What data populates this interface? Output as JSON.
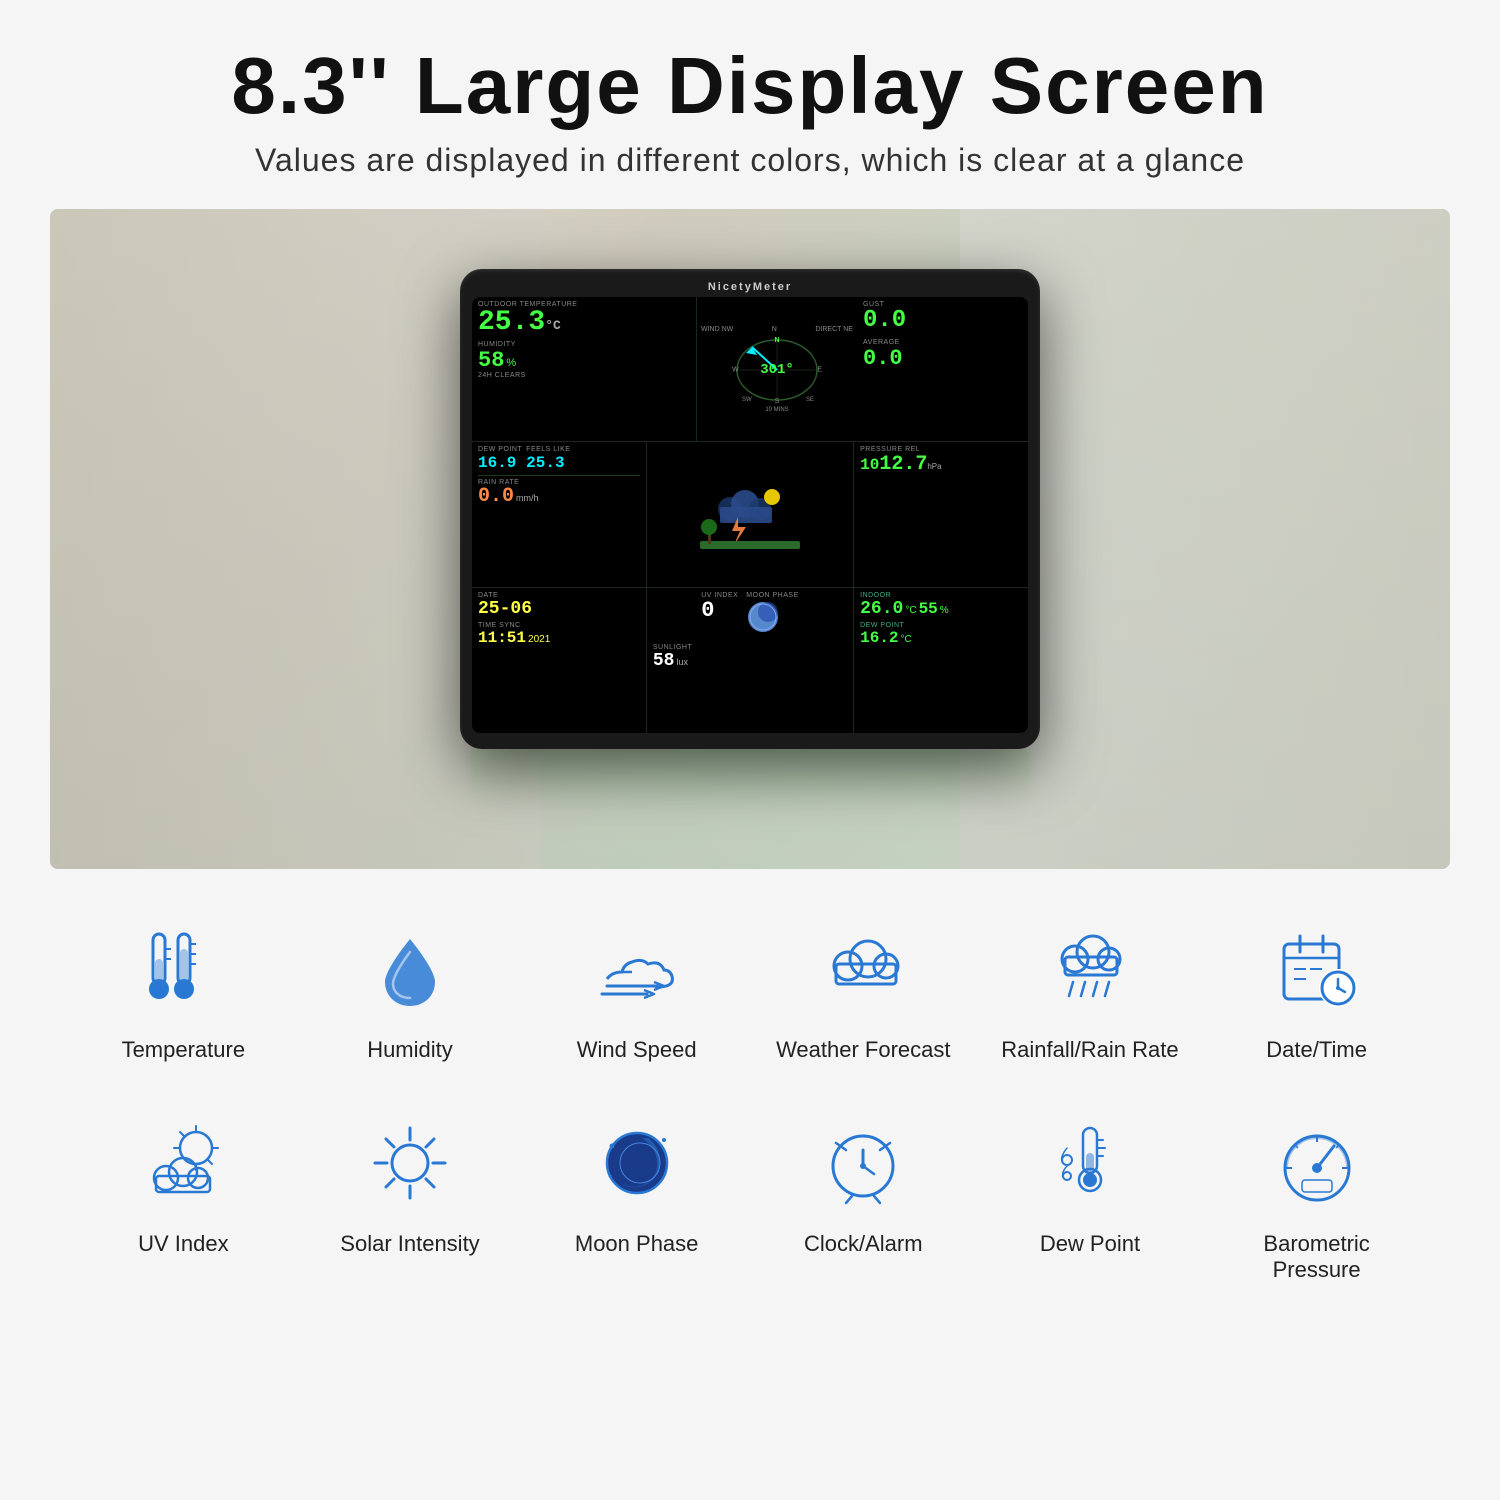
{
  "header": {
    "main_title": "8.3'' Large Display Screen",
    "subtitle": "Values are displayed in different colors, which is clear at a glance"
  },
  "device": {
    "brand": "NicetyMeter",
    "screen": {
      "outdoor_temp_label": "OUTDOOR TEMPERATURE",
      "outdoor_temp_value": "25.3",
      "outdoor_temp_unit": "°C",
      "humidity_label": "HUMIDITY",
      "humidity_value": "58",
      "humidity_unit": "%",
      "humidity_24h": "24h CLEARS",
      "wind_label": "WIND NW",
      "wind_direction_label": "DIRECT NE",
      "wind_compass_value": "301",
      "wind_compass_deg": "°",
      "wind_speed_label": "10 MINS",
      "gust_label": "GUST",
      "gust_value": "0.0",
      "dew_point_label": "DEW POINT",
      "dew_point_value": "16.9",
      "feels_like_label": "FEELS LIKE",
      "feels_like_value": "25.3",
      "average_label": "AVERAGE",
      "average_value": "0.0",
      "rain_rate_label": "RAIN RATE",
      "rain_rate_value": "0.0",
      "rain_unit": "mm/h",
      "pressure_label": "PRESSURE REL",
      "pressure_value1": "10",
      "pressure_value2": "12.7",
      "pressure_unit": "hPa",
      "date_label": "DATE",
      "date_value": "25-06",
      "uv_label": "UV INDEX",
      "uv_value": "0",
      "moon_label": "MOON PHASE",
      "time_label": "TIME SYNC",
      "time_value": "11:51",
      "time_year": "2021",
      "sunlight_label": "SUNLIGHT",
      "sunlight_value": "58",
      "sunlight_unit": "lux",
      "indoor_label": "INDOOR",
      "indoor_temp": "26.0",
      "indoor_temp_unit": "°C",
      "indoor_humidity": "55",
      "indoor_humidity_unit": "%",
      "indoor_dew_label": "DEW POINT",
      "indoor_dew_value": "16.2",
      "indoor_dew_unit": "°C"
    }
  },
  "features_row1": [
    {
      "id": "temperature",
      "label": "Temperature",
      "icon": "thermometer"
    },
    {
      "id": "humidity",
      "label": "Humidity",
      "icon": "droplet"
    },
    {
      "id": "wind-speed",
      "label": "Wind Speed",
      "icon": "wind"
    },
    {
      "id": "weather-forecast",
      "label": "Weather Forecast",
      "icon": "cloud"
    },
    {
      "id": "rainfall",
      "label": "Rainfall/Rain Rate",
      "icon": "rain-cloud"
    },
    {
      "id": "datetime",
      "label": "Date/Time",
      "icon": "calendar-clock"
    }
  ],
  "features_row2": [
    {
      "id": "uv-index",
      "label": "UV Index",
      "icon": "uv-cloud"
    },
    {
      "id": "solar-intensity",
      "label": "Solar Intensity",
      "icon": "sun"
    },
    {
      "id": "moon-phase",
      "label": "Moon Phase",
      "icon": "moon"
    },
    {
      "id": "clock-alarm",
      "label": "Clock/Alarm",
      "icon": "clock"
    },
    {
      "id": "dew-point",
      "label": "Dew Point",
      "icon": "dew"
    },
    {
      "id": "barometric-pressure",
      "label": "Barometric Pressure",
      "icon": "gauge"
    }
  ]
}
